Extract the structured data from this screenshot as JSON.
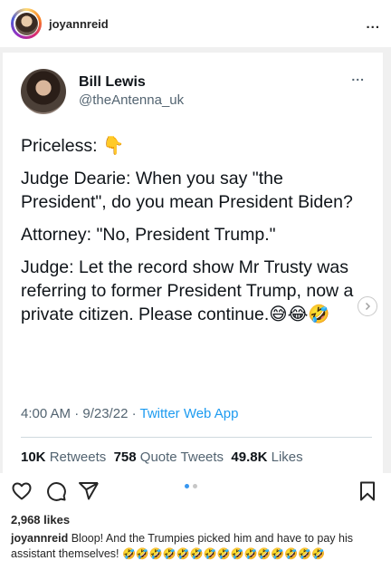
{
  "header": {
    "username": "joyannreid",
    "more": "..."
  },
  "tweet": {
    "name": "Bill Lewis",
    "handle": "@theAntenna_uk",
    "more": "...",
    "lines": [
      "Priceless: 👇",
      "Judge Dearie: When you say \"the President\", do you mean President Biden?",
      "Attorney: \"No, President Trump.\"",
      "Judge: Let the record show Mr Trusty was referring to former President Trump, now a private citizen. Please continue.😅😂🤣"
    ],
    "time": "4:00 AM · 9/23/22 · ",
    "source": "Twitter Web App",
    "retweets_count": "10K",
    "retweets_label": "Retweets",
    "quotes_count": "758",
    "quotes_label": "Quote Tweets",
    "likes_count": "49.8K",
    "likes_label": "Likes"
  },
  "post": {
    "likes": "2,968 likes",
    "caption_user": "joyannreid",
    "caption_text": "Bloop! And the Trumpies picked him and have to pay his assistant themselves!",
    "caption_emojis": "🤣🤣🤣🤣🤣🤣🤣🤣🤣🤣🤣🤣🤣🤣🤣"
  },
  "icons": {
    "like": "heart-icon",
    "comment": "comment-icon",
    "share": "send-icon",
    "save": "bookmark-icon",
    "carousel_next": "chevron-right-icon"
  },
  "colors": {
    "link": "#1d9bf0",
    "secondary_text": "#536471",
    "carousel_active": "#3897f0"
  }
}
